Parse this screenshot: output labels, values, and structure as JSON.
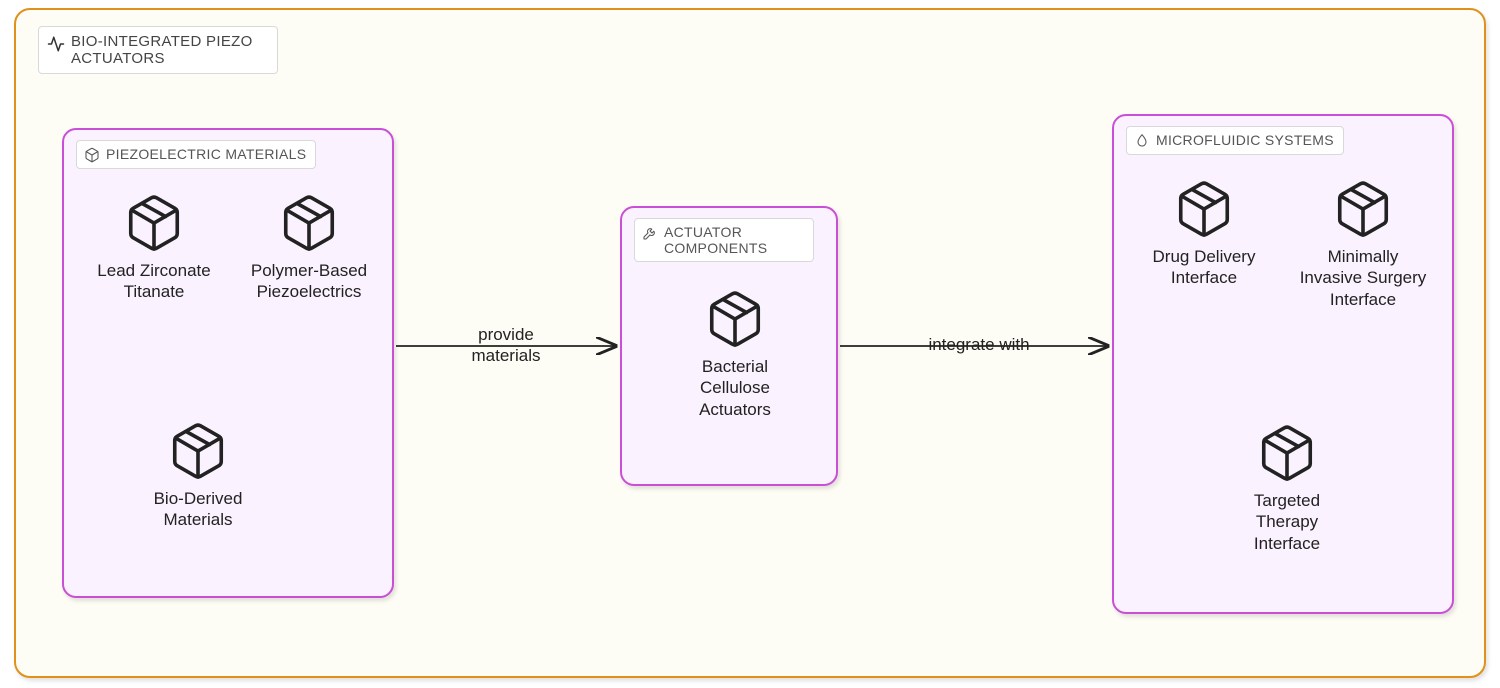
{
  "outer": {
    "label": "BIO-INTEGRATED PIEZO ACTUATORS"
  },
  "groups": {
    "piezo_materials": {
      "label": "PIEZOELECTRIC MATERIALS"
    },
    "actuator_components": {
      "label": "ACTUATOR COMPONENTS"
    },
    "microfluidic": {
      "label": "MICROFLUIDIC SYSTEMS"
    }
  },
  "nodes": {
    "lzt": "Lead Zirconate Titanate",
    "polymer": "Polymer-Based Piezoelectrics",
    "bioderived": "Bio-Derived Materials",
    "bacterial": "Bacterial Cellulose Actuators",
    "drug": "Drug Delivery Interface",
    "surgery": "Minimally Invasive Surgery Interface",
    "therapy": "Targeted Therapy Interface"
  },
  "edges": {
    "provide": "provide materials",
    "integrate": "integrate with"
  }
}
